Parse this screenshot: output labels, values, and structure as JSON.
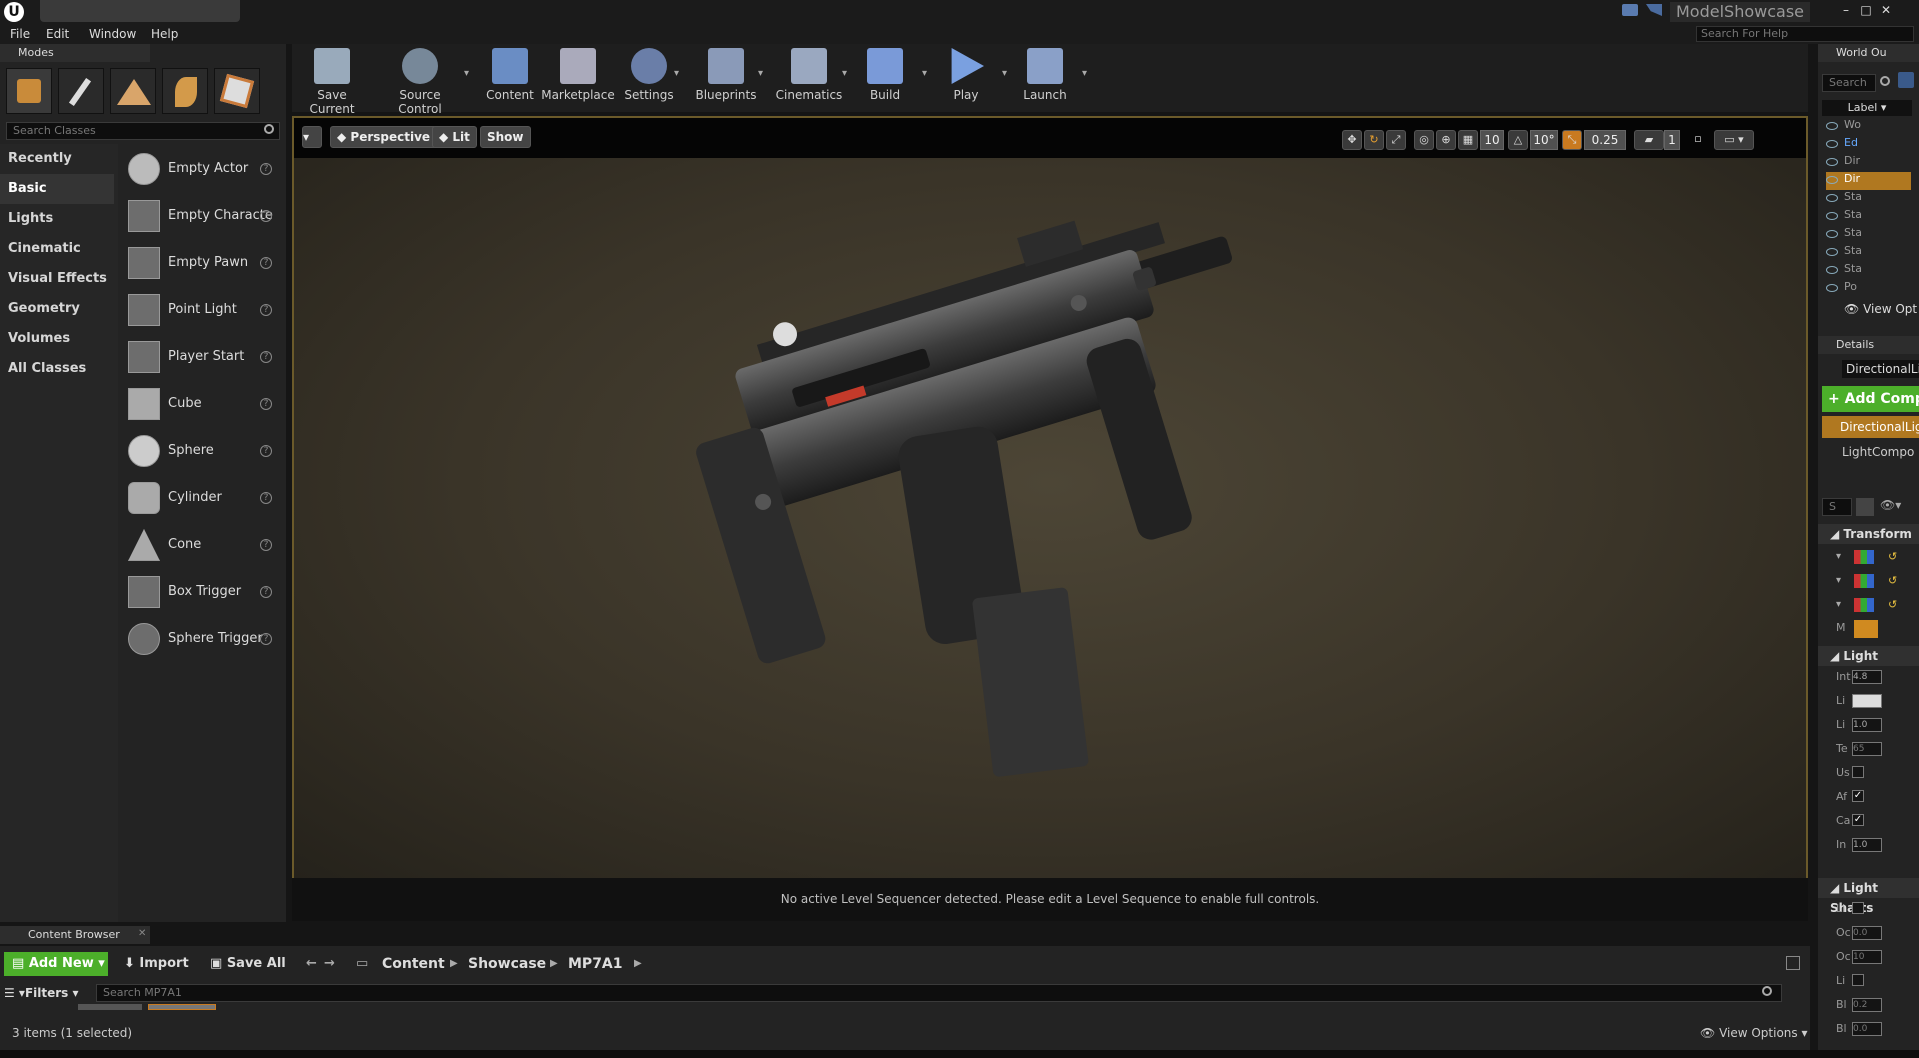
{
  "app_title": "ModelShowcase",
  "menu": [
    "File",
    "Edit",
    "Window",
    "Help"
  ],
  "help_search_placeholder": "Search For Help",
  "modes_panel": {
    "tab_label": "Modes",
    "search_placeholder": "Search Classes",
    "categories": [
      "Recently Placed",
      "Basic",
      "Lights",
      "Cinematic",
      "Visual Effects",
      "Geometry",
      "Volumes",
      "All Classes"
    ],
    "active_category": "Basic",
    "items": [
      "Empty Actor",
      "Empty Characte",
      "Empty Pawn",
      "Point Light",
      "Player Start",
      "Cube",
      "Sphere",
      "Cylinder",
      "Cone",
      "Box Trigger",
      "Sphere Trigger"
    ]
  },
  "toolbar": [
    {
      "label": "Save Current",
      "icon": "save-icon"
    },
    {
      "label": "Source Control",
      "icon": "source-control-icon"
    },
    {
      "label": "Content",
      "icon": "content-icon"
    },
    {
      "label": "Marketplace",
      "icon": "marketplace-icon"
    },
    {
      "label": "Settings",
      "icon": "settings-icon"
    },
    {
      "label": "Blueprints",
      "icon": "blueprints-icon"
    },
    {
      "label": "Cinematics",
      "icon": "cinematics-icon"
    },
    {
      "label": "Build",
      "icon": "build-icon"
    },
    {
      "label": "Play",
      "icon": "play-icon"
    },
    {
      "label": "Launch",
      "icon": "launch-icon"
    }
  ],
  "viewport": {
    "perspective_label": "Perspective",
    "lit_label": "Lit",
    "show_label": "Show",
    "grid_snap": "10",
    "rotation_snap": "10°",
    "scale_snap": "0.25",
    "camera_speed": "1",
    "sequencer_message": "No active Level Sequencer detected. Please edit a Level Sequence to enable full controls."
  },
  "world_outliner": {
    "tab_label": "World Ou",
    "search_placeholder": "Search",
    "label_header": "Label",
    "rows": [
      "Wo",
      "Ed",
      "Dir",
      "Dir",
      "Sta",
      "Sta",
      "Sta",
      "Sta",
      "Sta",
      "Po"
    ],
    "view_options": "View Opt"
  },
  "details": {
    "tab_label": "Details",
    "object_name": "DirectionalLig",
    "add_component": "+ Add Compo",
    "components": [
      "DirectionalLig",
      "LightCompo"
    ],
    "search_placeholder": "S",
    "transform_header": "Transform",
    "transform_rows": [
      "",
      "",
      "",
      "M"
    ],
    "light_header": "Light",
    "light_rows": [
      {
        "label": "Int",
        "value": "4.8"
      },
      {
        "label": "Li",
        "value": ""
      },
      {
        "label": "Li",
        "value": "1.0"
      },
      {
        "label": "Te",
        "value": "65"
      },
      {
        "label": "Us",
        "checked": false
      },
      {
        "label": "Af",
        "checked": true
      },
      {
        "label": "Ca",
        "checked": true
      },
      {
        "label": "In",
        "value": "1.0"
      }
    ],
    "shafts_header": "Light Shafts",
    "shafts_rows": [
      {
        "label": "Li",
        "checked": false
      },
      {
        "label": "Oc",
        "value": "0.0"
      },
      {
        "label": "Oc",
        "value": "10"
      },
      {
        "label": "Li",
        "checked": false
      },
      {
        "label": "Bl",
        "value": "0.2"
      },
      {
        "label": "Bl",
        "value": "0.0"
      }
    ]
  },
  "content_browser": {
    "tab_label": "Content Browser",
    "add_new": "Add New",
    "import": "Import",
    "save_all": "Save All",
    "breadcrumb": [
      "Content",
      "Showcase",
      "MP7A1"
    ],
    "filters": "Filters",
    "search_placeholder": "Search MP7A1",
    "status": "3 items (1 selected)",
    "view_options": "View Options"
  },
  "colors": {
    "accent_green": "#4caf2a",
    "viewport_border": "#6b5a2a",
    "selected_orange": "#b07820"
  }
}
